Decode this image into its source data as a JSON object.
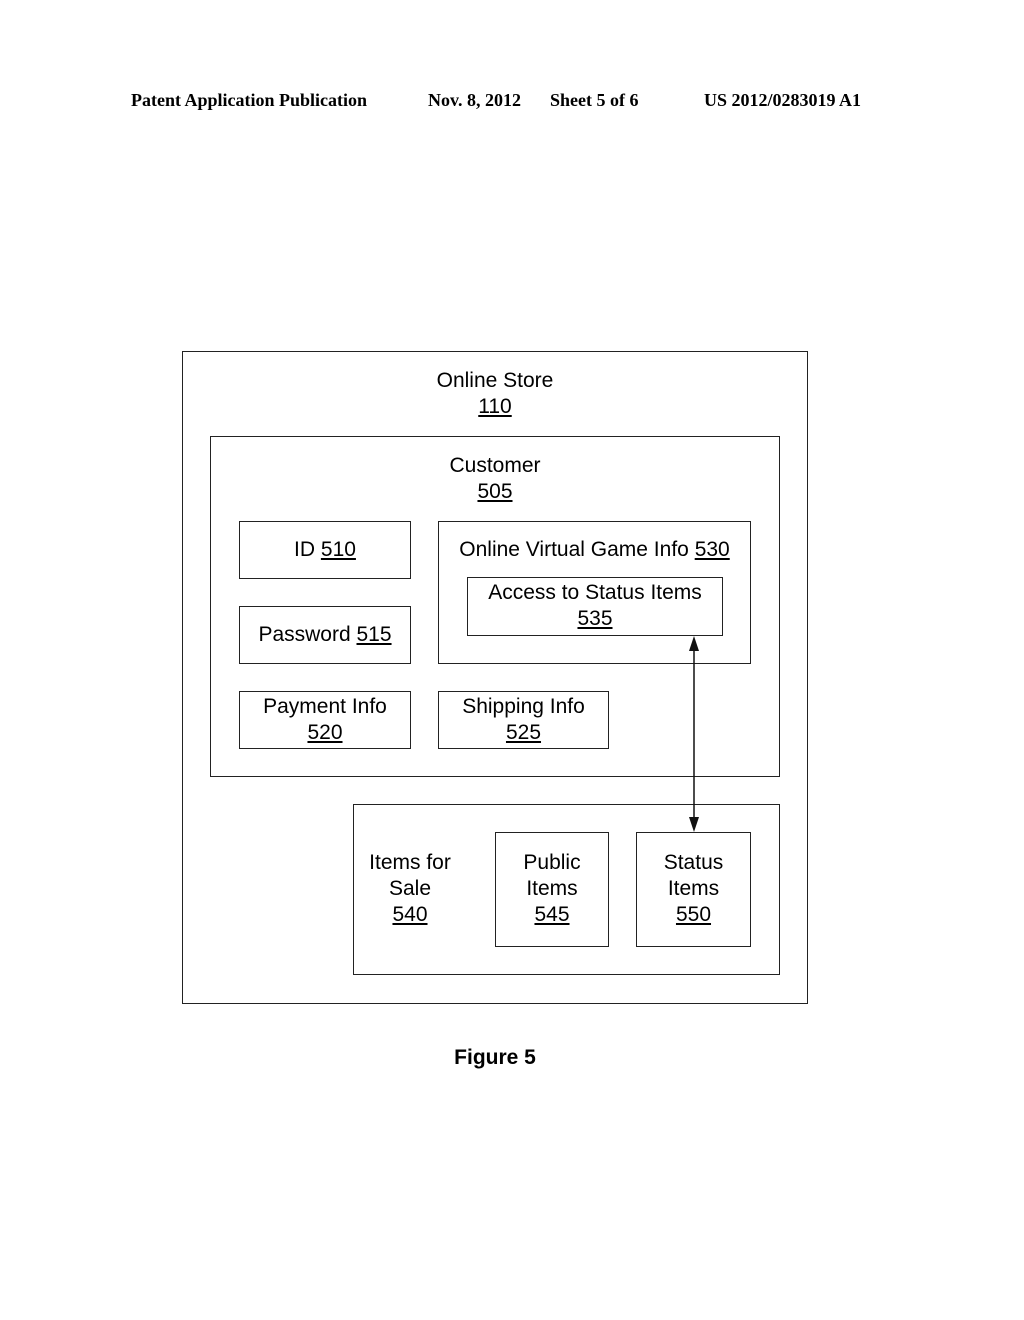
{
  "header": {
    "publication": "Patent Application Publication",
    "date": "Nov. 8, 2012",
    "sheet": "Sheet 5 of 6",
    "number": "US 2012/0283019 A1"
  },
  "diagram": {
    "online_store": {
      "label": "Online Store",
      "ref": "110"
    },
    "customer": {
      "label": "Customer",
      "ref": "505"
    },
    "id": {
      "label": "ID",
      "ref": "510"
    },
    "password": {
      "label": "Password",
      "ref": "515"
    },
    "payment_info": {
      "label": "Payment Info",
      "ref": "520"
    },
    "shipping_info": {
      "label": "Shipping Info",
      "ref": "525"
    },
    "game_info": {
      "label": "Online Virtual Game Info",
      "ref": "530"
    },
    "access_status": {
      "label": "Access to Status Items",
      "ref": "535"
    },
    "items_for_sale": {
      "label_line1": "Items for",
      "label_line2": "Sale",
      "ref": "540"
    },
    "public_items": {
      "label_line1": "Public",
      "label_line2": "Items",
      "ref": "545"
    },
    "status_items": {
      "label_line1": "Status",
      "label_line2": "Items",
      "ref": "550"
    },
    "connection": "bidirectional arrow between Access to Status Items 535 and Status Items 550"
  },
  "caption": "Figure 5"
}
